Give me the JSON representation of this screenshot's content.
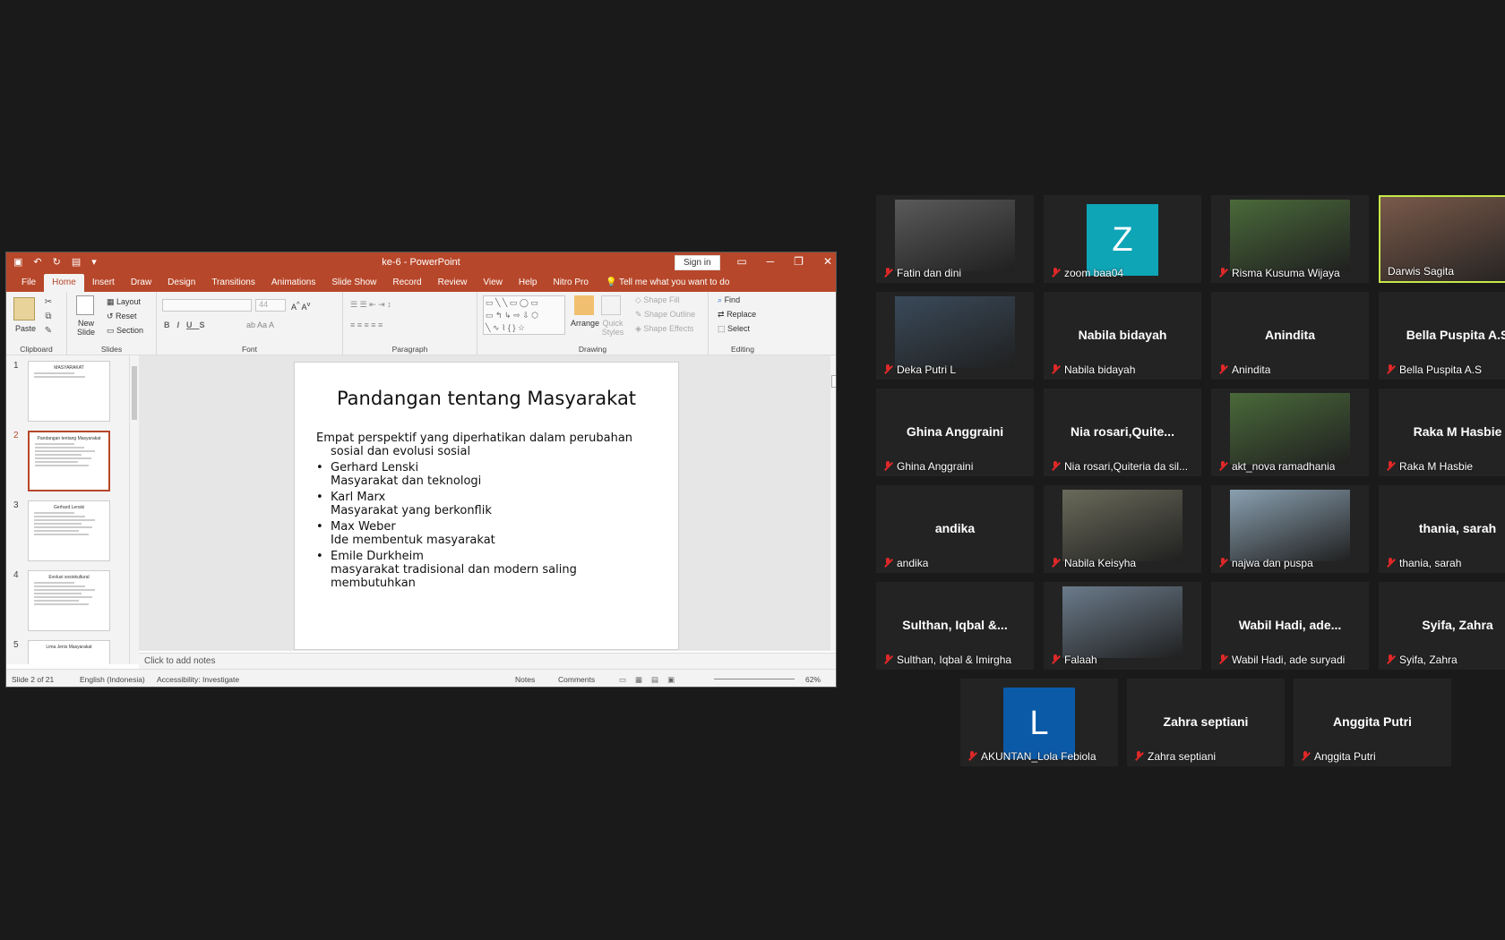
{
  "powerpoint": {
    "window_title": "ke-6  -  PowerPoint",
    "sign_in_label": "Sign in",
    "tabs": [
      "File",
      "Home",
      "Insert",
      "Draw",
      "Design",
      "Transitions",
      "Animations",
      "Slide Show",
      "Record",
      "Review",
      "View",
      "Help",
      "Nitro Pro"
    ],
    "active_tab": "Home",
    "tell_me": "Tell me what you want to do",
    "ribbon": {
      "clipboard": {
        "label": "Clipboard",
        "paste": "Paste"
      },
      "slides": {
        "label": "Slides",
        "new_slide": "New Slide",
        "layout": "Layout",
        "reset": "Reset",
        "section": "Section"
      },
      "font": {
        "label": "Font",
        "size": "44"
      },
      "paragraph": {
        "label": "Paragraph"
      },
      "drawing": {
        "label": "Drawing",
        "arrange": "Arrange",
        "quick_styles": "Quick Styles",
        "shape_fill": "Shape Fill",
        "shape_outline": "Shape Outline",
        "shape_effects": "Shape Effects"
      },
      "editing": {
        "label": "Editing",
        "find": "Find",
        "replace": "Replace",
        "select": "Select"
      }
    },
    "thumbnails": [
      {
        "num": "1",
        "title": "MASYARAKAT"
      },
      {
        "num": "2",
        "title": "Pandangan tentang Masyarakat"
      },
      {
        "num": "3",
        "title": "Gerhard Lenski"
      },
      {
        "num": "4",
        "title": "Evolusi sosiokultural"
      },
      {
        "num": "5",
        "title": "Lima Jenis Masyarakat"
      }
    ],
    "slide": {
      "title": "Pandangan tentang Masyarakat",
      "intro_line1": "Empat perspektif yang diperhatikan dalam perubahan",
      "intro_line2": "sosial dan evolusi sosial",
      "items": [
        {
          "name": "Gerhard Lenski",
          "desc": "Masyarakat dan teknologi"
        },
        {
          "name": "Karl Marx",
          "desc": "Masyarakat yang berkonflik"
        },
        {
          "name": "Max Weber",
          "desc": "Ide membentuk masyarakat"
        },
        {
          "name": "Emile Durkheim",
          "desc": "masyarakat tradisional dan modern saling",
          "desc2": "membutuhkan"
        }
      ]
    },
    "notes_placeholder": "Click to add notes",
    "status": {
      "slide_count": "Slide 2 of 21",
      "language": "English (Indonesia)",
      "accessibility": "Accessibility: Investigate",
      "notes": "Notes",
      "comments": "Comments",
      "zoom": "62%"
    }
  },
  "zoom": {
    "participants": [
      {
        "name": "Fatin dan dini",
        "display": "video",
        "muted": true
      },
      {
        "name": "zoom baa04",
        "display": "avatar",
        "letter": "Z",
        "color": "#0ea5b7",
        "muted": true
      },
      {
        "name": "Risma Kusuma Wijaya",
        "display": "video",
        "muted": true
      },
      {
        "name": "Darwis Sagita",
        "display": "video",
        "muted": false,
        "active": true
      },
      {
        "name": "Deka Putri L",
        "display": "video",
        "muted": true
      },
      {
        "name": "Nabila bidayah",
        "display": "text",
        "center": "Nabila bidayah",
        "muted": true
      },
      {
        "name": "Anindita",
        "display": "text",
        "center": "Anindita",
        "muted": true
      },
      {
        "name": "Bella Puspita A.S",
        "display": "text",
        "center": "Bella Puspita A.S",
        "muted": true
      },
      {
        "name": "Ghina Anggraini",
        "display": "text",
        "center": "Ghina Anggraini",
        "muted": true
      },
      {
        "name": "Nia rosari,Quiteria da sil...",
        "display": "text",
        "center": "Nia  rosari,Quite...",
        "muted": true
      },
      {
        "name": "akt_nova ramadhania",
        "display": "video",
        "muted": true
      },
      {
        "name": "Raka M Hasbie",
        "display": "text",
        "center": "Raka M Hasbie",
        "muted": true
      },
      {
        "name": "andika",
        "display": "text",
        "center": "andika",
        "muted": true
      },
      {
        "name": "Nabila Keisyha",
        "display": "video",
        "muted": true
      },
      {
        "name": "najwa dan puspa",
        "display": "video",
        "muted": true
      },
      {
        "name": "thania, sarah",
        "display": "text",
        "center": "thania, sarah",
        "muted": true
      },
      {
        "name": "Sulthan, Iqbal & Imirgha",
        "display": "text",
        "center": "Sulthan,  Iqbal &...",
        "muted": true
      },
      {
        "name": "Falaah",
        "display": "video",
        "muted": true
      },
      {
        "name": "Wabil Hadi, ade suryadi",
        "display": "text",
        "center": "Wabil  Hadi,  ade...",
        "muted": true
      },
      {
        "name": "Syifa, Zahra",
        "display": "text",
        "center": "Syifa, Zahra",
        "muted": true
      },
      {
        "name": "AKUNTAN_Lola Febiola",
        "display": "avatar",
        "letter": "L",
        "color": "#0b5aa8",
        "muted": true
      },
      {
        "name": "Zahra septiani",
        "display": "text",
        "center": "Zahra septiani",
        "muted": true
      },
      {
        "name": "Anggita Putri",
        "display": "text",
        "center": "Anggita Putri",
        "muted": true
      }
    ]
  }
}
